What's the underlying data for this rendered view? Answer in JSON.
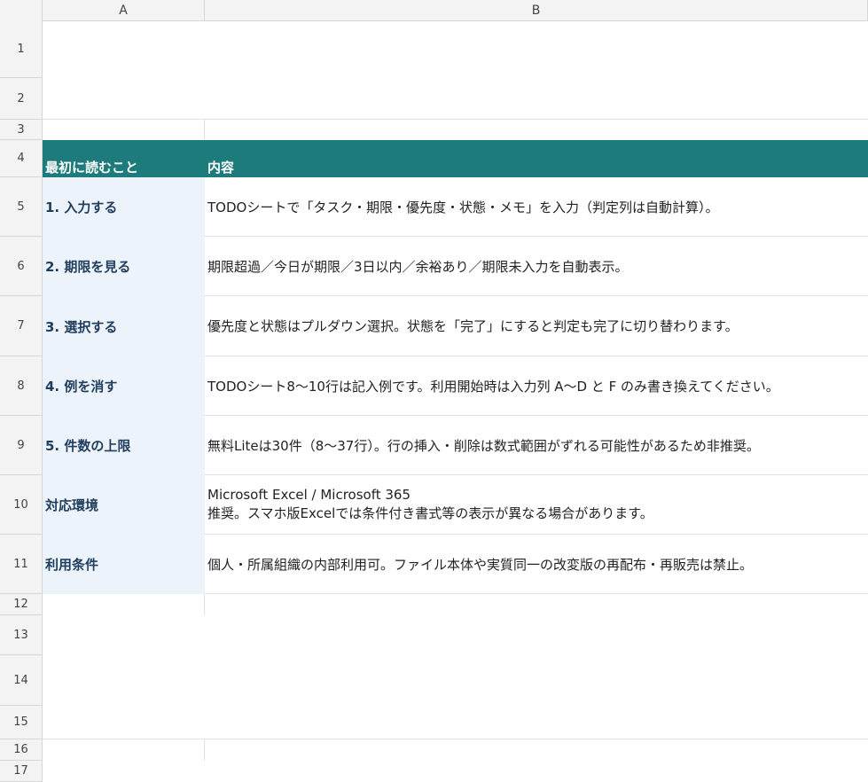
{
  "columns": [
    "A",
    "B"
  ],
  "rows": {
    "r1": "1",
    "r2": "2",
    "r3": "3",
    "r4": "4",
    "r5": "5",
    "r6": "6",
    "r7": "7",
    "r8": "8",
    "r9": "9",
    "r10": "10",
    "r11": "11",
    "r12": "12",
    "r13": "13",
    "r14": "14",
    "r15": "15",
    "r16": "16",
    "r17": "17"
  },
  "table": {
    "header_a": "最初に読むこと",
    "header_b": "内容",
    "items": [
      {
        "label": "1. 入力する",
        "content": "TODOシートで「タスク・期限・優先度・状態・メモ」を入力（判定列は自動計算）。"
      },
      {
        "label": "2. 期限を見る",
        "content": "期限超過／今日が期限／3日以内／余裕あり／期限未入力を自動表示。"
      },
      {
        "label": "3. 選択する",
        "content": "優先度と状態はプルダウン選択。状態を「完了」にすると判定も完了に切り替わります。"
      },
      {
        "label": "4. 例を消す",
        "content": "TODOシート8〜10行は記入例です。利用開始時は入力列 A〜D と F のみ書き換えてください。"
      },
      {
        "label": "5. 件数の上限",
        "content": "無料Liteは30件（8〜37行）。行の挿入・削除は数式範囲がずれる可能性があるため非推奨。"
      },
      {
        "label": "対応環境",
        "content_line1": "Microsoft Excel / Microsoft 365",
        "content_line2": "推奨。スマホ版Excelでは条件付き書式等の表示が異なる場合があります。"
      },
      {
        "label": "利用条件",
        "content": "個人・所属組織の内部利用可。ファイル本体や実質同一の改変版の再配布・再販売は禁止。"
      }
    ]
  },
  "colors": {
    "header_bg": "#1e7b7b",
    "label_bg": "#edf3fa",
    "label_text": "#1f3d5c"
  }
}
